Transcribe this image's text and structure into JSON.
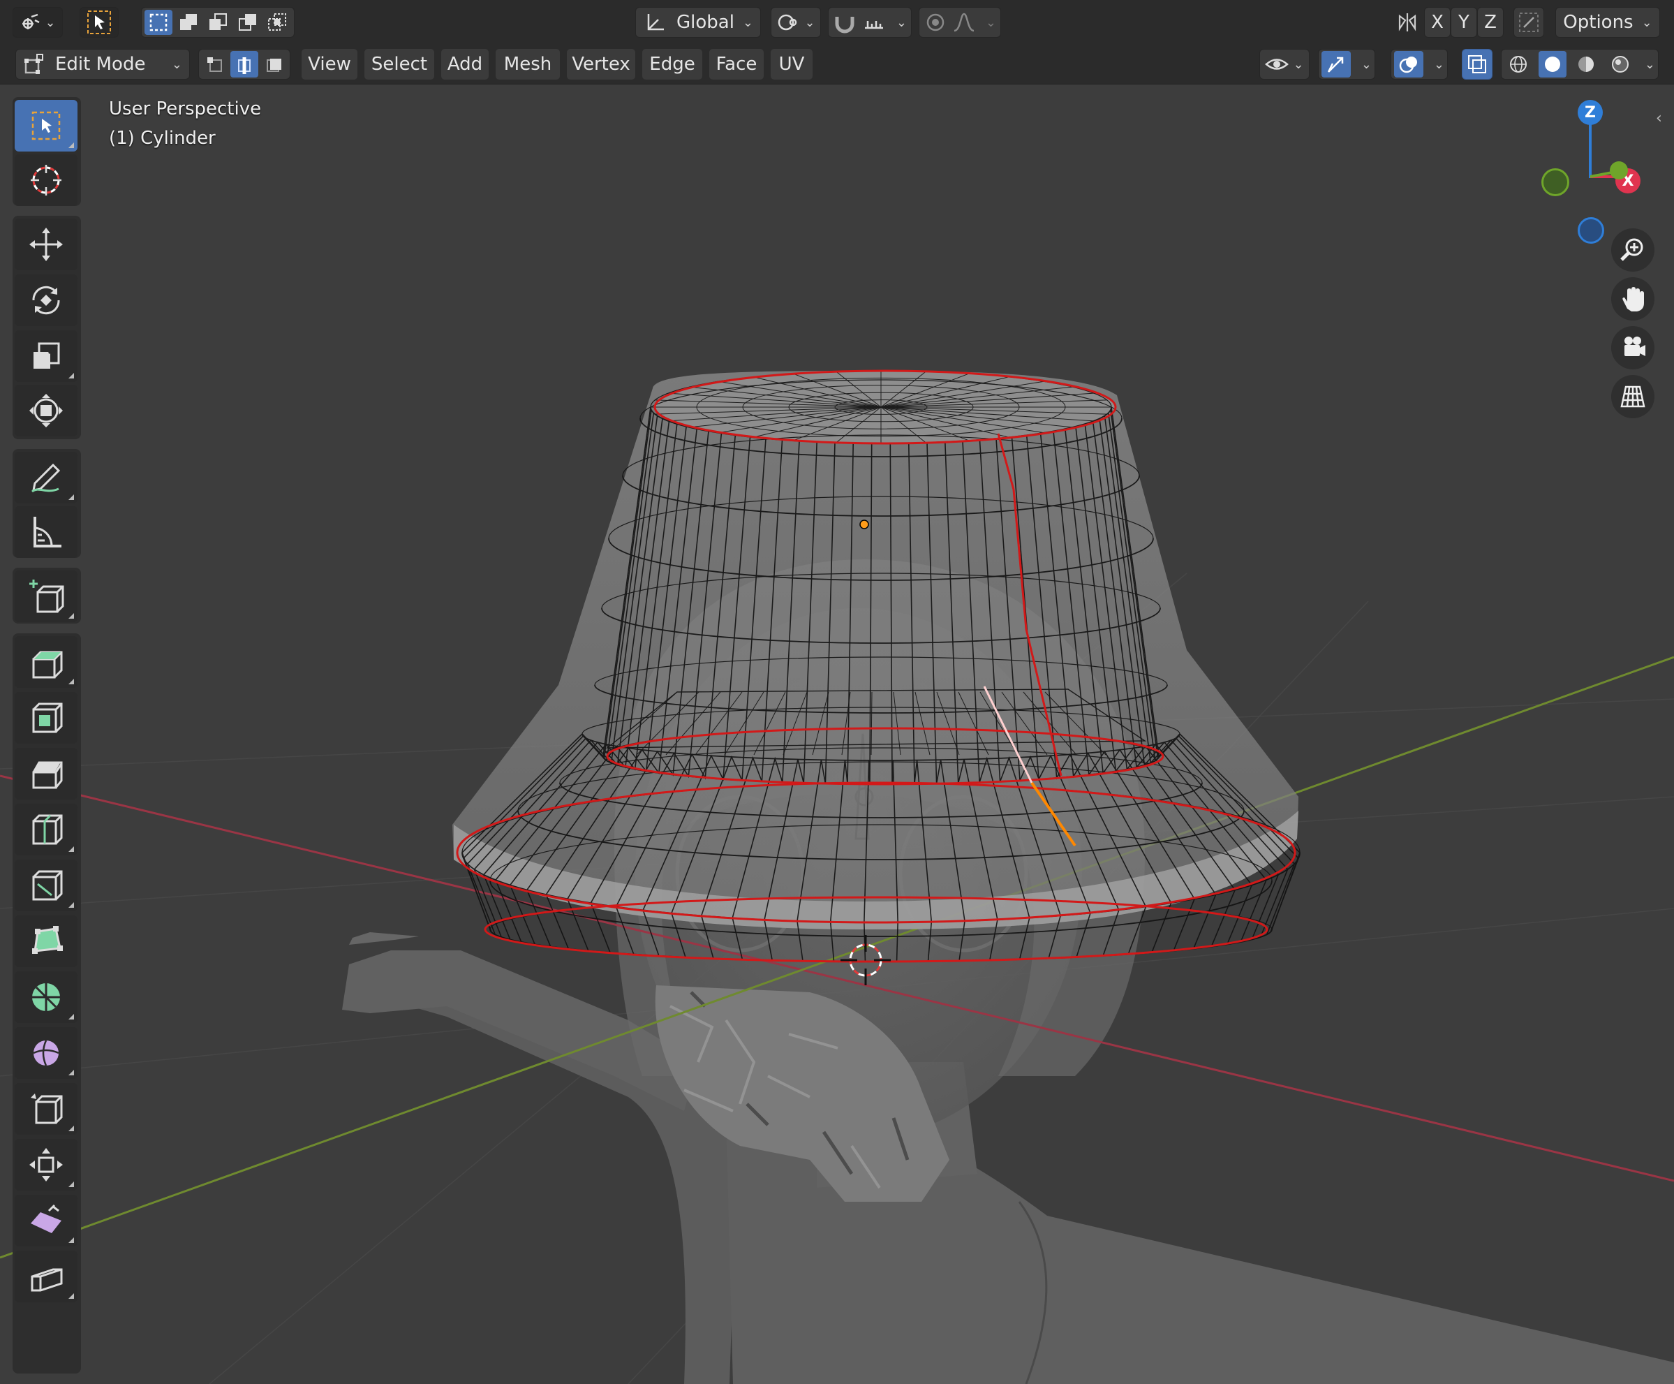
{
  "header": {
    "transform_orientation": "Global",
    "axis_x": "X",
    "axis_y": "Y",
    "axis_z": "Z",
    "options_label": "Options"
  },
  "header2": {
    "mode": "Edit Mode",
    "menus": [
      "View",
      "Select",
      "Add",
      "Mesh",
      "Vertex",
      "Edge",
      "Face",
      "UV"
    ]
  },
  "viewport": {
    "view_name": "User Perspective",
    "object_name": "(1) Cylinder"
  },
  "gizmo": {
    "z": "Z",
    "x": "X"
  },
  "toolbar": {
    "tools": [
      "select-box",
      "cursor",
      "move",
      "rotate",
      "scale",
      "transform",
      "annotate",
      "measure",
      "add-cube",
      "extrude-region",
      "inset-faces",
      "bevel",
      "loop-cut",
      "knife",
      "poly-build",
      "spin",
      "smooth",
      "edge-slide",
      "shrink-fatten",
      "shear",
      "rip-region"
    ]
  },
  "colors": {
    "background": "#3d3d3d",
    "header": "#2b2b2b",
    "accent": "#4772b3",
    "x_axis": "#e0344f",
    "y_axis": "#6fa52a",
    "z_axis": "#2f7ed8",
    "seam": "#d21919"
  }
}
